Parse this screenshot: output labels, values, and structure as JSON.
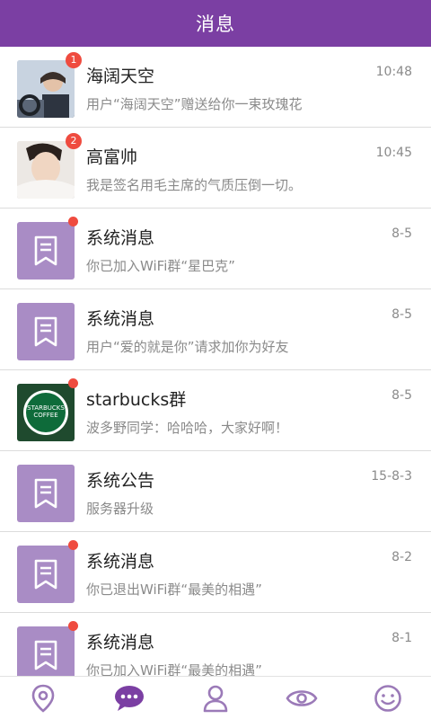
{
  "header": {
    "title": "消息"
  },
  "colors": {
    "brand": "#7b3fa3",
    "system_avatar": "#a98cc5",
    "badge": "#ef4b3f"
  },
  "messages": [
    {
      "name": "海阔天空",
      "preview": "用户“海阔天空”赠送给你一束玫瑰花",
      "time": "10:48",
      "badge": "1",
      "avatar": "photo"
    },
    {
      "name": "高富帅",
      "preview": "我是签名用毛主席的气质压倒一切。",
      "time": "10:45",
      "badge": "2",
      "avatar": "photo"
    },
    {
      "name": "系统消息",
      "preview": "你已加入WiFi群“星巴克”",
      "time": "8-5",
      "unread_dot": true,
      "avatar": "bookmark-icon"
    },
    {
      "name": "系统消息",
      "preview": "用户“爱的就是你”请求加你为好友",
      "time": "8-5",
      "unread_dot": false,
      "avatar": "bookmark-icon"
    },
    {
      "name": "starbucks群",
      "preview": "波多野同学：哈哈哈，大家好啊！",
      "time": "8-5",
      "unread_dot": true,
      "avatar": "starbucks-logo",
      "logo_text": "STARBUCKS COFFEE"
    },
    {
      "name": "系统公告",
      "preview": "服务器升级",
      "time": "15-8-3",
      "unread_dot": false,
      "avatar": "bookmark-icon"
    },
    {
      "name": "系统消息",
      "preview": "你已退出WiFi群“最美的相遇”",
      "time": "8-2",
      "unread_dot": true,
      "avatar": "bookmark-icon"
    },
    {
      "name": "系统消息",
      "preview": "你已加入WiFi群“最美的相遇”",
      "time": "8-1",
      "unread_dot": true,
      "avatar": "bookmark-icon"
    }
  ],
  "tabbar": {
    "tabs": [
      {
        "icon": "location-pin-icon",
        "active": false
      },
      {
        "icon": "chat-bubble-icon",
        "active": true
      },
      {
        "icon": "person-icon",
        "active": false
      },
      {
        "icon": "eye-icon",
        "active": false
      },
      {
        "icon": "smiley-icon",
        "active": false
      }
    ]
  }
}
